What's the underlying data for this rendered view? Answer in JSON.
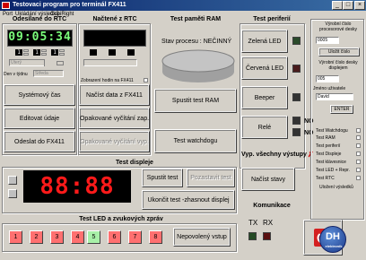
{
  "window": {
    "title": "Testovaci program pro terminál FX411",
    "min": "_",
    "max": "□",
    "close": "×"
  },
  "menu": [
    "Port",
    "Ukládání výsledků",
    "CopiRight"
  ],
  "rtc_send": {
    "title": "Odesílané do RTC",
    "clock": "09:05:34",
    "boxes": [
      "1",
      "1",
      "1"
    ],
    "date_combo": "Úterý",
    "week_label": "Den v týdnu",
    "week_combo": "Středa",
    "buttons": [
      "Systémový čas",
      "Editovat údaje",
      "Odeslat do FX411"
    ]
  },
  "rtc_load": {
    "title": "Načtené z RTC",
    "clock": "",
    "check_label": "Zobrazení hodin na FX411",
    "buttons": [
      "Načíst data z FX411",
      "Opakované vyčítání zap.",
      "Opakované vyčítání vyp."
    ]
  },
  "ram": {
    "title": "Test paměti RAM",
    "status": "Stav procesu : NEČINNÝ",
    "button": "Spustit test RAM",
    "watchdog": "Test watchdogu"
  },
  "periph": {
    "title": "Test periferií",
    "buttons": [
      "Zelená LED",
      "Červená LED",
      "Beeper",
      "Relé"
    ],
    "no1": "NO",
    "no2": "NO",
    "all_off": "Vyp. všechny výstupy",
    "all_off_x": "✗",
    "read_state": "Načíst stavy"
  },
  "side": {
    "label1": "Výrobní číslo procesorové desky",
    "value1": "0005",
    "btn1": "Uložit číslo",
    "label2": "Výrobní číslo desky displejem",
    "value2": "005",
    "label3": "Jméno uživatele",
    "value3": "David",
    "enter": "ENTER",
    "checks": [
      "Test Watchdogu",
      "Test RAM",
      "Test periferií",
      "Test Displeje",
      "Test klávesnice",
      "Test LED + Repr.",
      "Test RTC"
    ],
    "save_label": "Uložení výsledků"
  },
  "display": {
    "title": "Test displeje",
    "digits": "88:88",
    "start": "Spustit test",
    "stop": "Pozastavit test",
    "end": "Ukončit test  -zhasnout displej"
  },
  "leds": {
    "title": "Test LED a zvukových zpráv",
    "items": [
      "1",
      "2",
      "3",
      "4",
      "5",
      "6",
      "7",
      "8"
    ],
    "allowed": "Nepovolený vstup"
  },
  "comm": {
    "title": "Komunikace",
    "tx": "TX",
    "rx": "RX"
  },
  "logo": {
    "text": "DH",
    "sub": "elektronik"
  }
}
